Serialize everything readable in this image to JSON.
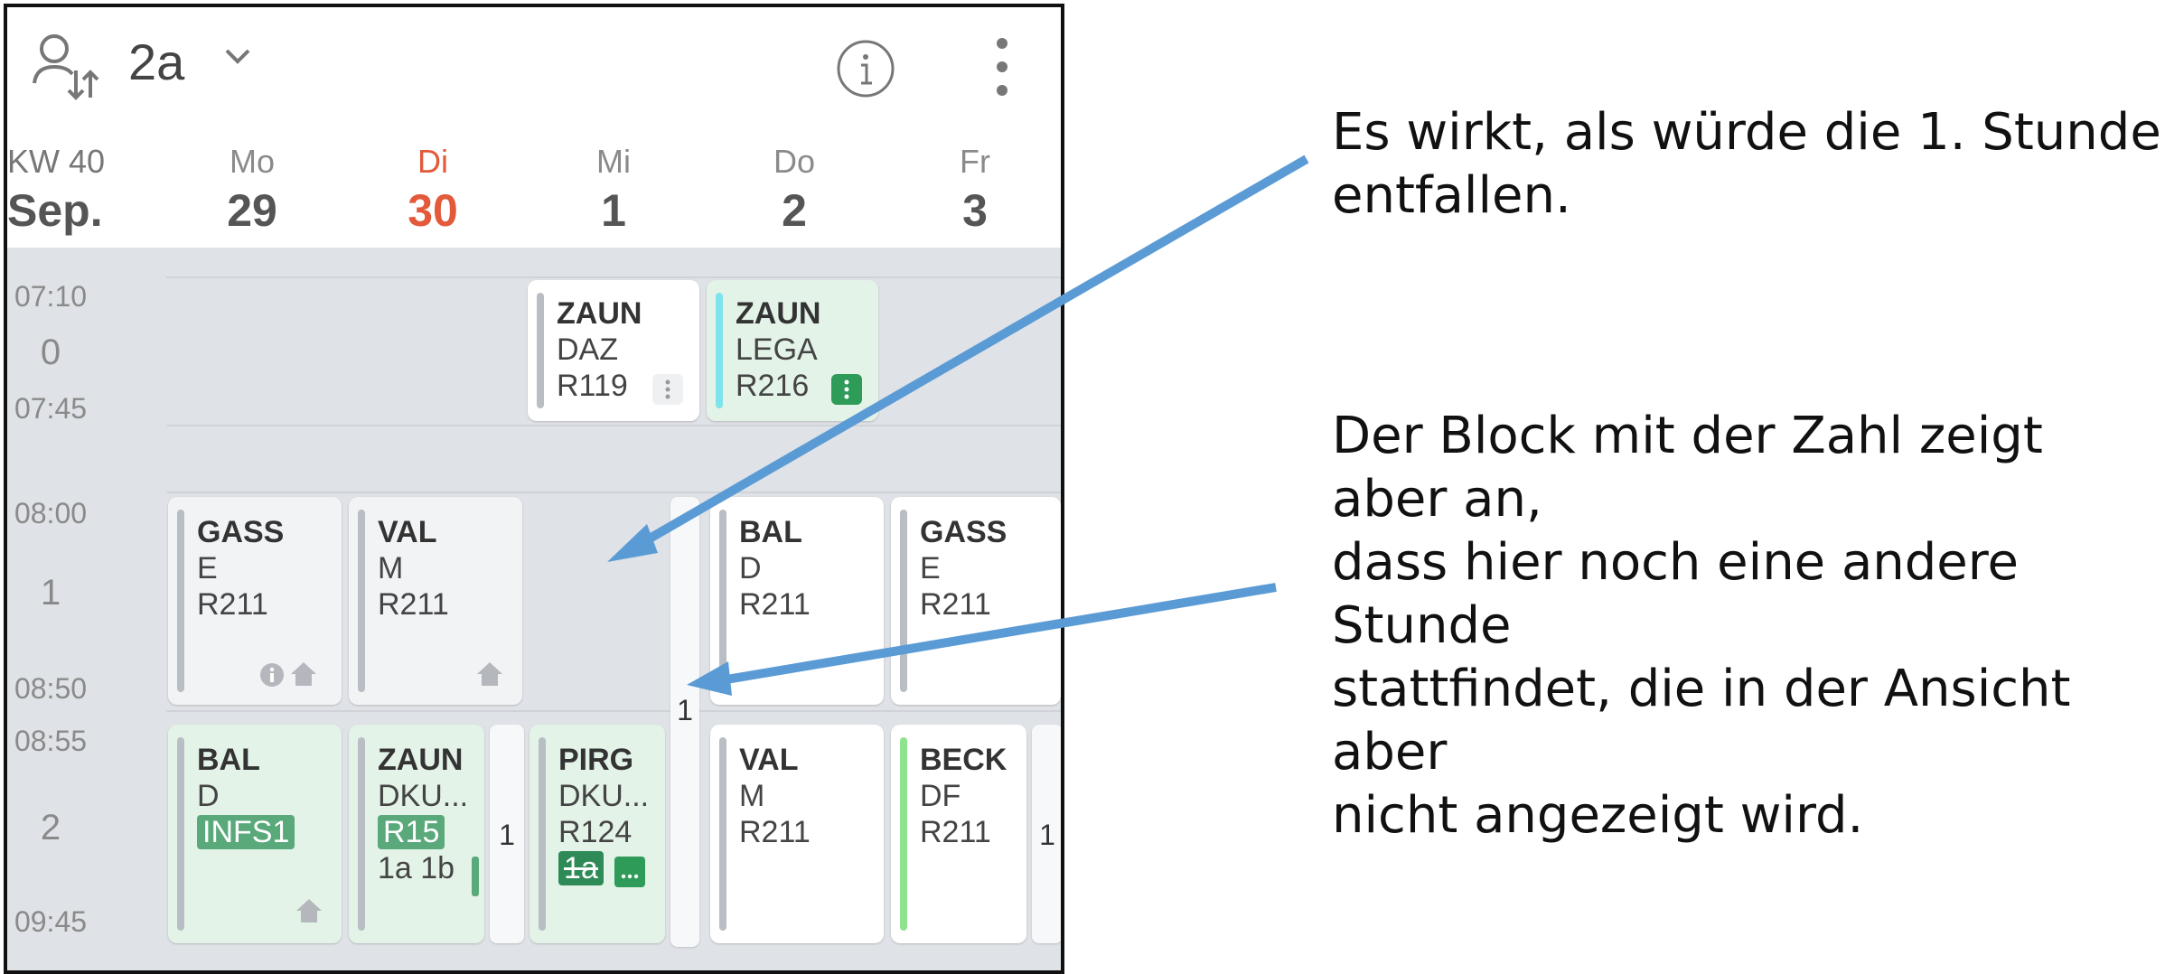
{
  "topbar": {
    "class_name": "2a",
    "icons": [
      "person-swap-icon",
      "chevron-down-icon",
      "info-icon",
      "more-vertical-icon"
    ]
  },
  "header": {
    "week": "KW 40",
    "month": "Sep.",
    "days": [
      {
        "abbr": "Mo",
        "num": "29"
      },
      {
        "abbr": "Di",
        "num": "30"
      },
      {
        "abbr": "Mi",
        "num": "1"
      },
      {
        "abbr": "Do",
        "num": "2"
      },
      {
        "abbr": "Fr",
        "num": "3"
      }
    ]
  },
  "times": {
    "p0": {
      "start": "07:10",
      "label": "0",
      "end": "07:45"
    },
    "p1": {
      "start": "08:00",
      "label": "1",
      "end": "08:50"
    },
    "p2": {
      "start": "08:55",
      "label": "2",
      "end": "09:45"
    }
  },
  "lessons": {
    "mi0": {
      "teacher": "ZAUN",
      "subject": "DAZ",
      "room": "R119"
    },
    "do0": {
      "teacher": "ZAUN",
      "subject": "LEGA",
      "room": "R216"
    },
    "mo1": {
      "teacher": "GASS",
      "subject": "E",
      "room": "R211"
    },
    "di1": {
      "teacher": "VAL",
      "subject": "M",
      "room": "R211"
    },
    "do1": {
      "teacher": "BAL",
      "subject": "D",
      "room": "R211"
    },
    "fr1": {
      "teacher": "GASS",
      "subject": "E",
      "room": "R211"
    },
    "mo2": {
      "teacher": "BAL",
      "subject": "D",
      "room": "INFS1"
    },
    "di2": {
      "teacher": "ZAUN",
      "subject": "DKU...",
      "room": "R15",
      "classes": "1a 1b"
    },
    "mi2": {
      "teacher": "PIRG",
      "subject": "DKU...",
      "room": "R124",
      "class": "1a"
    },
    "do2": {
      "teacher": "VAL",
      "subject": "M",
      "room": "R211"
    },
    "fr2": {
      "teacher": "BECK",
      "subject": "DF",
      "room": "R211"
    }
  },
  "counts": {
    "mi1": "1",
    "di2": "1",
    "fr2": "1"
  },
  "annotations": {
    "note1": [
      "Es wirkt, als würde die 1. Stunde",
      "entfallen."
    ],
    "note2": [
      "Der Block mit der Zahl zeigt aber an,",
      "dass hier noch eine andere Stunde",
      "stattfindet, die in der Ansicht aber",
      "nicht angezeigt wird."
    ]
  },
  "colors": {
    "today": "#e25a3a",
    "arrow": "#5b9bd5",
    "green_card": "#e3f3e8",
    "grid_bg": "#dfe2e6"
  }
}
